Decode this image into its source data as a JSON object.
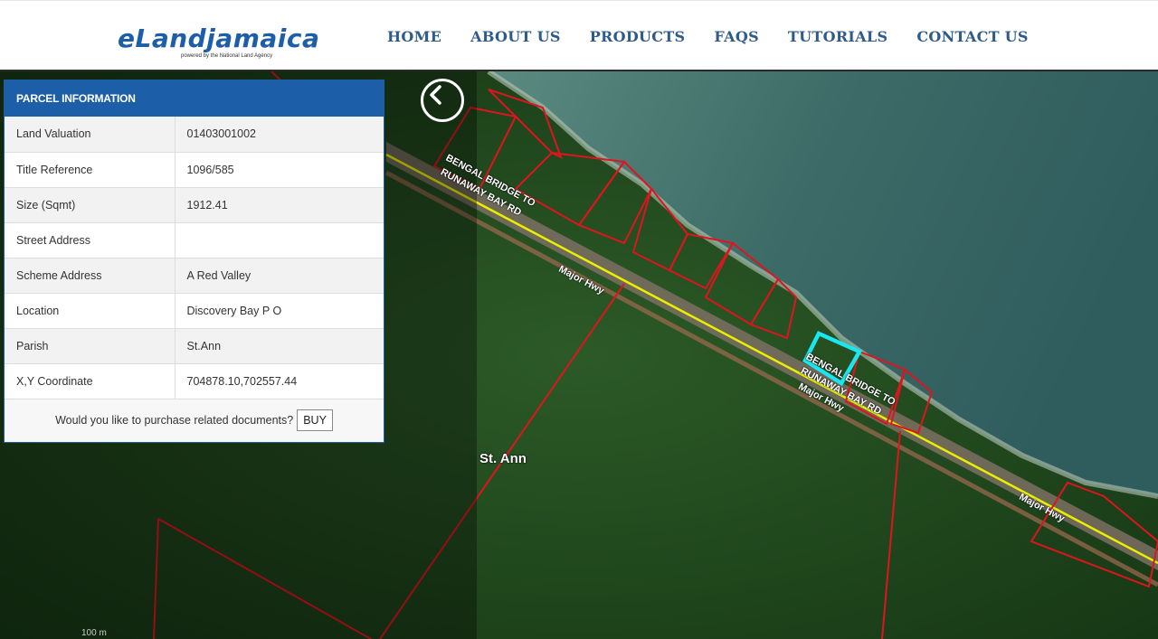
{
  "brand": {
    "name": "eLandjamaica",
    "tagline": "powered by the National Land Agency"
  },
  "nav": [
    "HOME",
    "ABOUT US",
    "PRODUCTS",
    "FAQS",
    "TUTORIALS",
    "CONTACT US"
  ],
  "panel": {
    "title": "PARCEL INFORMATION",
    "rows": [
      {
        "label": "Land Valuation",
        "value": "01403001002"
      },
      {
        "label": "Title Reference",
        "value": "1096/585"
      },
      {
        "label": "Size (Sqmt)",
        "value": "1912.41"
      },
      {
        "label": "Street Address",
        "value": ""
      },
      {
        "label": "Scheme Address",
        "value": "A Red Valley"
      },
      {
        "label": "Location",
        "value": "Discovery Bay P O"
      },
      {
        "label": "Parish",
        "value": "St.Ann"
      },
      {
        "label": "X,Y Coordinate",
        "value": "704878.10,702557.44"
      }
    ],
    "purchase_prompt": "Would you like to purchase related documents?",
    "buy_label": "BUY"
  },
  "map": {
    "labels": {
      "road1_line1": "BENGAL BRIDGE TO",
      "road1_line2": "RUNAWAY BAY RD",
      "road2_line1": "BENGAL BRIDGE TO",
      "road2_line2": "RUNAWAY BAY RD",
      "hwy1": "Major Hwy",
      "hwy2": "Major Hwy",
      "hwy3": "Major Hwy",
      "parish": "St. Ann",
      "scale": "100 m"
    },
    "icons": {
      "back": "chevron-left-circle-icon"
    },
    "colors": {
      "parcel": "#e0141e",
      "selected": "#19e6f0",
      "road": "#e8f000",
      "sea": "#3f6e66",
      "land": "#1f4a1e"
    }
  }
}
